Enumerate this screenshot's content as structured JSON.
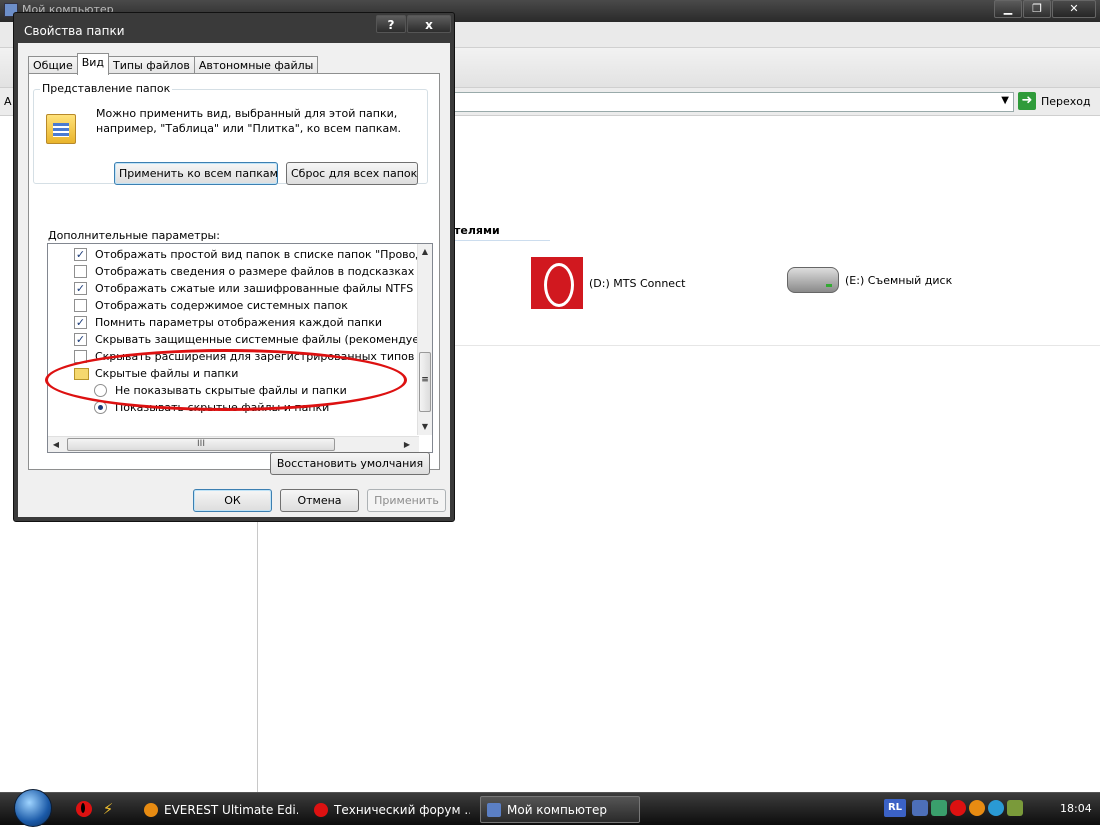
{
  "explorer": {
    "title": "Мой компьютер",
    "address_label": "А",
    "go_label": "Переход",
    "section_title": "телями",
    "drives": [
      {
        "label": "(D:) MTS Connect"
      },
      {
        "label": "(E:) Съемный диск"
      }
    ]
  },
  "dialog": {
    "title": "Свойства папки",
    "help_label": "?",
    "close_label": "x",
    "tabs": [
      {
        "label": "Общие"
      },
      {
        "label": "Вид"
      },
      {
        "label": "Типы файлов"
      },
      {
        "label": "Автономные файлы"
      }
    ],
    "folder_views": {
      "heading": "Представление папок",
      "description": "Можно применить вид, выбранный для этой папки, например, \"Таблица\" или \"Плитка\", ко всем папкам.",
      "apply_all_label": "Применить ко всем папкам",
      "reset_all_label": "Сброс для всех папок"
    },
    "advanced_label": "Дополнительные параметры:",
    "options": [
      {
        "label": "Отображать простой вид папок в списке папок \"Проводни",
        "checked": true
      },
      {
        "label": "Отображать сведения о размере файлов в подсказках па",
        "checked": false
      },
      {
        "label": "Отображать сжатые или зашифрованные файлы NTFS др",
        "checked": true
      },
      {
        "label": "Отображать содержимое системных папок",
        "checked": false
      },
      {
        "label": "Помнить параметры отображения каждой папки",
        "checked": true
      },
      {
        "label": "Скрывать защищенные системные файлы (рекомендуетс",
        "checked": true
      },
      {
        "label": "Скрывать расширения для зарегистрированных типов фа",
        "checked": false
      }
    ],
    "hidden_files_folder": "Скрытые файлы и папки",
    "radios": [
      {
        "label": "Не показывать скрытые файлы и папки",
        "selected": false
      },
      {
        "label": "Показывать скрытые файлы и папки",
        "selected": true
      }
    ],
    "hscroll_grip": "III",
    "vscroll_grip": "≡",
    "restore_defaults_label": "Восстановить умолчания",
    "ok_label": "ОК",
    "cancel_label": "Отмена",
    "apply_label": "Применить"
  },
  "taskbar": {
    "tasks": [
      {
        "label": "EVEREST Ultimate Edi..."
      },
      {
        "label": "Технический форум ..."
      },
      {
        "label": "Мой компьютер"
      }
    ],
    "lang": "RL",
    "clock": "18:04"
  },
  "colors": {
    "accent_red": "#d11",
    "go_green": "#2f9b3a",
    "mts_red": "#d1181f"
  }
}
